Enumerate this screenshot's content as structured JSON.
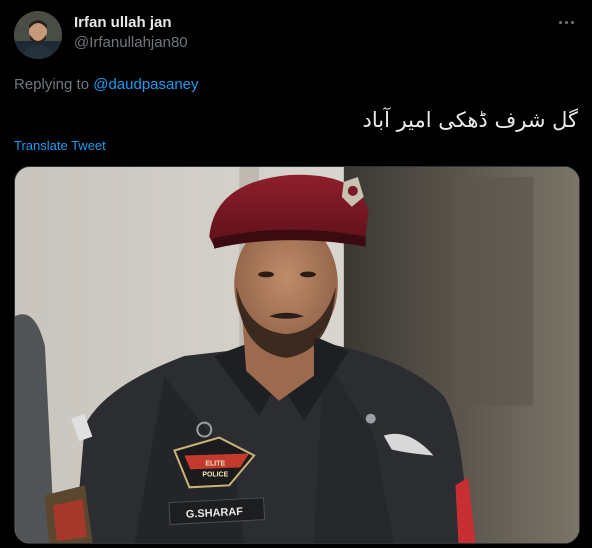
{
  "tweet": {
    "author": {
      "name": "Irfan ullah jan",
      "handle": "@Irfanullahjan80"
    },
    "reply": {
      "prefix": "Replying to",
      "mention": "@daudpasaney"
    },
    "text": "گل شرف ڈھکی امیر آباد",
    "translate_label": "Translate Tweet",
    "media": {
      "badge_lines": [
        "ELITE",
        "POLICE"
      ],
      "name_tag": "G.SHARAF"
    }
  }
}
